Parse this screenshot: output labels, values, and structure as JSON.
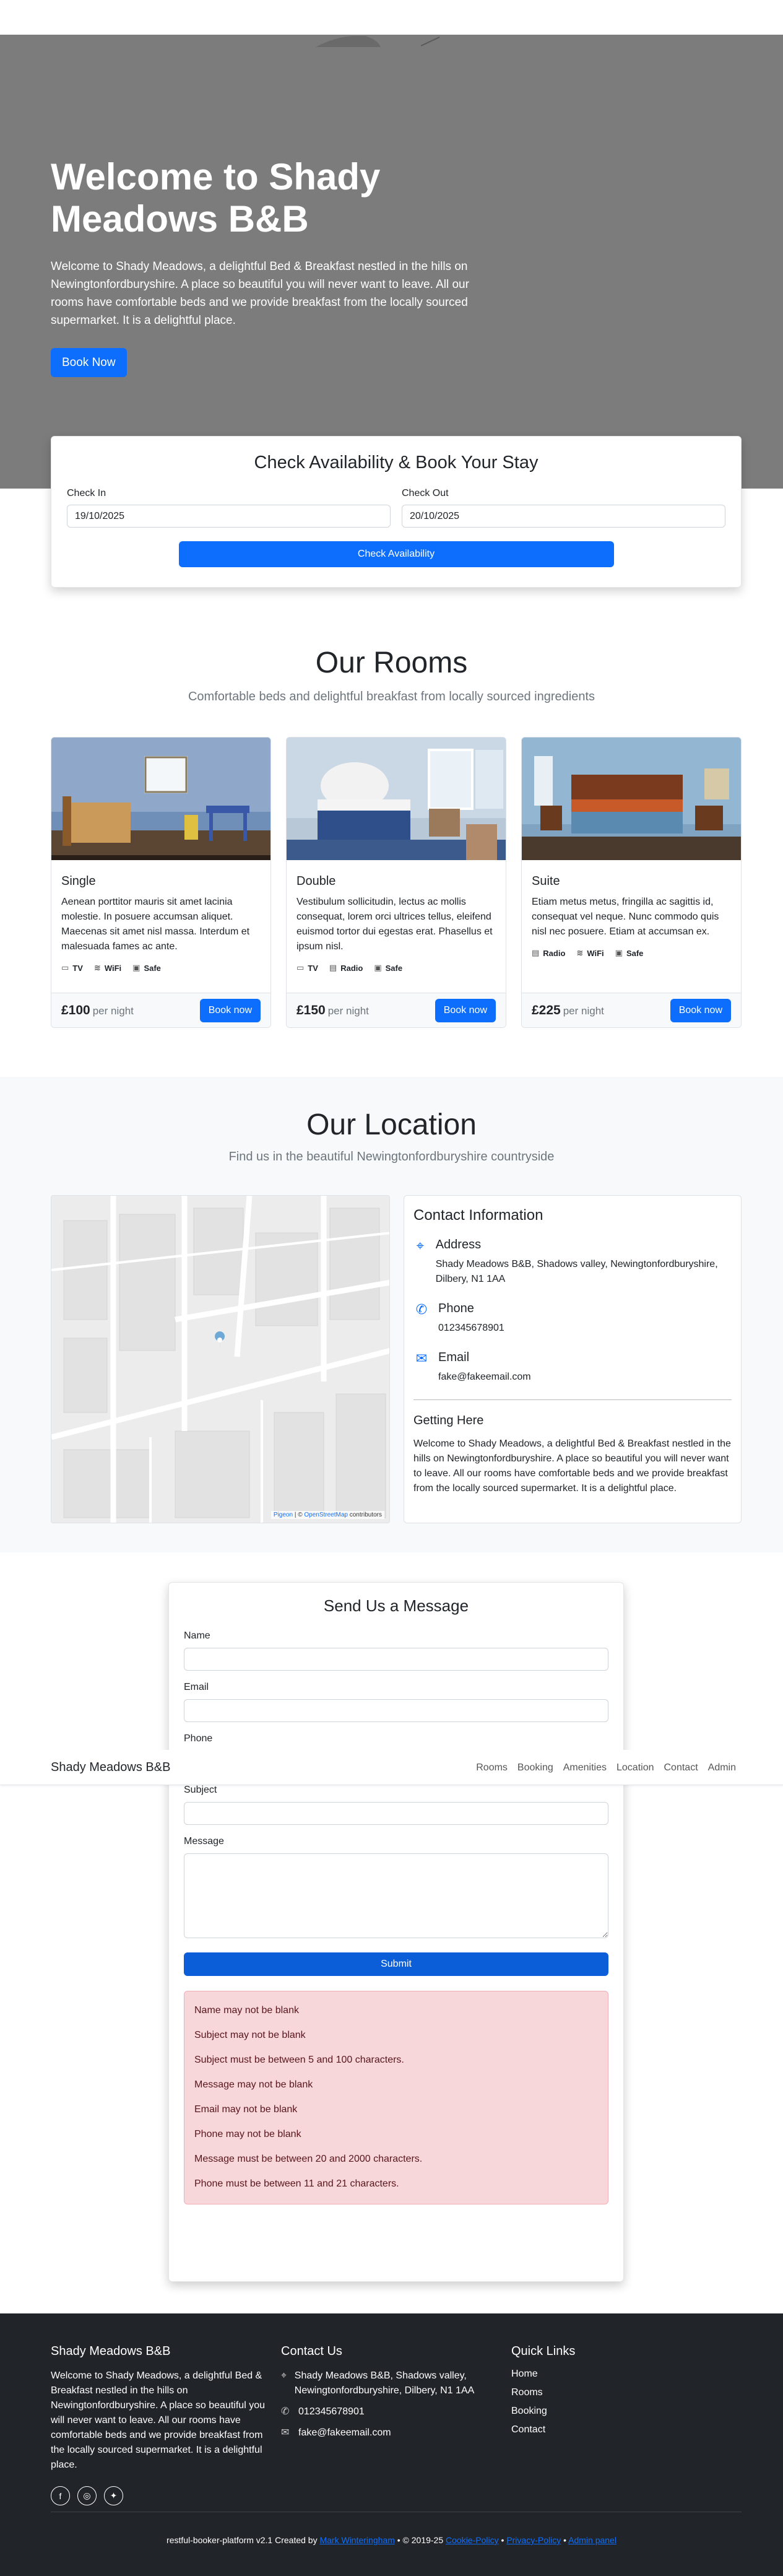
{
  "hero": {
    "title": "Welcome to Shady Meadows B&B",
    "description": "Welcome to Shady Meadows, a delightful Bed & Breakfast nestled in the hills on Newingtonfordburyshire. A place so beautiful you will never want to leave. All our rooms have comfortable beds and we provide breakfast from the locally sourced supermarket. It is a delightful place.",
    "book_button": "Book Now",
    "bg_color": "#7c7c7c"
  },
  "booking": {
    "title": "Check Availability & Book Your Stay",
    "checkin_label": "Check In",
    "checkin_value": "19/10/2025",
    "checkout_label": "Check Out",
    "checkout_value": "20/10/2025",
    "button": "Check Availability"
  },
  "rooms": {
    "title": "Our Rooms",
    "subtitle": "Comfortable beds and delightful breakfast from locally sourced ingredients",
    "per_night": "per night",
    "book_button": "Book now",
    "items": [
      {
        "name": "Single",
        "description": "Aenean porttitor mauris sit amet lacinia molestie. In posuere accumsan aliquet. Maecenas sit amet nisl massa. Interdum et malesuada fames ac ante.",
        "features": [
          "TV",
          "WiFi",
          "Safe"
        ],
        "feature_icons": [
          "tv-icon",
          "wifi-icon",
          "safe-icon"
        ],
        "price": "£100"
      },
      {
        "name": "Double",
        "description": "Vestibulum sollicitudin, lectus ac mollis consequat, lorem orci ultrices tellus, eleifend euismod tortor dui egestas erat. Phasellus et ipsum nisl.",
        "features": [
          "TV",
          "Radio",
          "Safe"
        ],
        "feature_icons": [
          "tv-icon",
          "radio-icon",
          "safe-icon"
        ],
        "price": "£150"
      },
      {
        "name": "Suite",
        "description": "Etiam metus metus, fringilla ac sagittis id, consequat vel neque. Nunc commodo quis nisl nec posuere. Etiam at accumsan ex.",
        "features": [
          "Radio",
          "WiFi",
          "Safe"
        ],
        "feature_icons": [
          "radio-icon",
          "wifi-icon",
          "safe-icon"
        ],
        "price": "£225"
      }
    ]
  },
  "location": {
    "title": "Our Location",
    "subtitle": "Find us in the beautiful Newingtonfordburyshire countryside",
    "map_attribution_1": "Pigeon",
    "map_attribution_2": " | © ",
    "map_attribution_3": "OpenStreetMap",
    "map_attribution_4": " contributors",
    "contact_title": "Contact Information",
    "address_label": "Address",
    "address_value": "Shady Meadows B&B, Shadows valley, Newingtonfordburyshire, Dilbery, N1 1AA",
    "phone_label": "Phone",
    "phone_value": "012345678901",
    "email_label": "Email",
    "email_value": "fake@fakeemail.com",
    "getting_title": "Getting Here",
    "getting_text": "Welcome to Shady Meadows, a delightful Bed & Breakfast nestled in the hills on Newingtonfordburyshire. A place so beautiful you will never want to leave. All our rooms have comfortable beds and we provide breakfast from the locally sourced supermarket. It is a delightful place."
  },
  "message": {
    "title": "Send Us a Message",
    "name_label": "Name",
    "email_label": "Email",
    "phone_label": "Phone",
    "subject_label": "Subject",
    "message_label": "Message",
    "submit": "Submit",
    "errors": [
      "Name may not be blank",
      "Subject may not be blank",
      "Subject must be between 5 and 100 characters.",
      "Message may not be blank",
      "Email may not be blank",
      "Phone may not be blank",
      "Message must be between 20 and 2000 characters.",
      "Phone must be between 11 and 21 characters."
    ]
  },
  "navbar": {
    "brand": "Shady Meadows B&B",
    "links": [
      "Rooms",
      "Booking",
      "Amenities",
      "Location",
      "Contact",
      "Admin"
    ]
  },
  "footer": {
    "brand": "Shady Meadows B&B",
    "about": "Welcome to Shady Meadows, a delightful Bed & Breakfast nestled in the hills on Newingtonfordburyshire. A place so beautiful you will never want to leave. All our rooms have comfortable beds and we provide breakfast from the locally sourced supermarket. It is a delightful place.",
    "contact_title": "Contact Us",
    "contact_address": "Shady Meadows B&B, Shadows valley, Newingtonfordburyshire, Dilbery, N1 1AA",
    "contact_phone": "012345678901",
    "contact_email": "fake@fakeemail.com",
    "links_title": "Quick Links",
    "links": [
      "Home",
      "Rooms",
      "Booking",
      "Contact"
    ],
    "copyright_prefix": "restful-booker-platform v2.1 Created by ",
    "author": "Mark Winteringham",
    "copyright_mid": " • © 2019-25 ",
    "cookie_policy": "Cookie-Policy",
    "sep1": " • ",
    "privacy_policy": "Privacy-Policy",
    "sep2": " • ",
    "admin_panel": "Admin panel"
  },
  "colors": {
    "primary": "#0d6efd",
    "footer_bg": "#212529",
    "section_bg": "#f8f9fa",
    "error_bg": "#f8d7da"
  }
}
